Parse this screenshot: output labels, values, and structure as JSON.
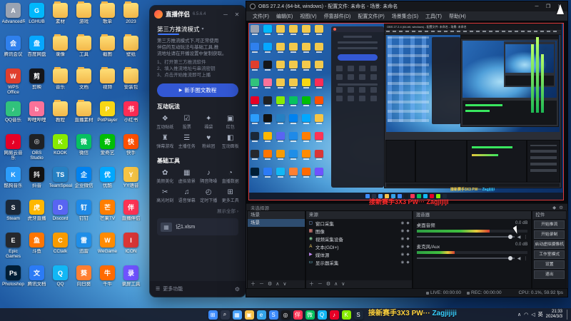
{
  "watermark": {
    "cn": "接新赛手3X3 PW···",
    "en": "Zagjijiji"
  },
  "window_controls": {
    "min": "─",
    "max": "❐",
    "close": "✕"
  },
  "desktop": {
    "icons": [
      {
        "label": "AdvancedRun",
        "color": "#9aa3b2",
        "glyph": "A",
        "type": "app"
      },
      {
        "label": "腾讯会议",
        "color": "#2f80ed",
        "glyph": "会",
        "type": "app"
      },
      {
        "label": "WPS Office",
        "color": "#e03e2d",
        "glyph": "W",
        "type": "app"
      },
      {
        "label": "QQ音乐",
        "color": "#31c27c",
        "glyph": "♪",
        "type": "app"
      },
      {
        "label": "网易云音乐",
        "color": "#e60026",
        "glyph": "♪",
        "type": "app"
      },
      {
        "label": "酷狗音乐",
        "color": "#2c9dfb",
        "glyph": "K",
        "type": "app"
      },
      {
        "label": "Steam",
        "color": "#1b2838",
        "glyph": "S",
        "type": "app"
      },
      {
        "label": "Epic Games",
        "color": "#26282d",
        "glyph": "E",
        "type": "app"
      },
      {
        "label": "Photoshop",
        "color": "#001e36",
        "glyph": "Ps",
        "type": "app"
      },
      {
        "label": "LGHUB",
        "color": "#00b8fc",
        "glyph": "G",
        "type": "app"
      },
      {
        "label": "百度网盘",
        "color": "#06a7ff",
        "glyph": "盘",
        "type": "app"
      },
      {
        "label": "剪映",
        "color": "#15161a",
        "glyph": "剪",
        "type": "app"
      },
      {
        "label": "哔哩哔哩",
        "color": "#fb7299",
        "glyph": "b",
        "type": "app"
      },
      {
        "label": "OBS Studio",
        "color": "#1f2124",
        "glyph": "◎",
        "type": "app"
      },
      {
        "label": "抖音",
        "color": "#121212",
        "glyph": "抖",
        "type": "app"
      },
      {
        "label": "虎牙直播",
        "color": "#ffb700",
        "glyph": "虎",
        "type": "app"
      },
      {
        "label": "斗鱼",
        "color": "#ff7500",
        "glyph": "鱼",
        "type": "app"
      },
      {
        "label": "腾讯文档",
        "color": "#2b7bf6",
        "glyph": "文",
        "type": "app"
      },
      {
        "label": "素材",
        "color": "",
        "glyph": "",
        "type": "folder"
      },
      {
        "label": "录像",
        "color": "",
        "glyph": "",
        "type": "folder"
      },
      {
        "label": "音乐",
        "color": "",
        "glyph": "",
        "type": "folder"
      },
      {
        "label": "教程",
        "color": "",
        "glyph": "",
        "type": "folder"
      },
      {
        "label": "KOOK",
        "color": "#87eb00",
        "glyph": "K",
        "type": "app"
      },
      {
        "label": "TeamSpeak",
        "color": "#2580c3",
        "glyph": "TS",
        "type": "app"
      },
      {
        "label": "Discord",
        "color": "#5865f2",
        "glyph": "D",
        "type": "app"
      },
      {
        "label": "CCtalk",
        "color": "#f89b00",
        "glyph": "C",
        "type": "app"
      },
      {
        "label": "QQ",
        "color": "#12b7f5",
        "glyph": "Q",
        "type": "app"
      },
      {
        "label": "游戏",
        "color": "",
        "glyph": "",
        "type": "folder"
      },
      {
        "label": "工具",
        "color": "",
        "glyph": "",
        "type": "folder"
      },
      {
        "label": "文档",
        "color": "",
        "glyph": "",
        "type": "folder"
      },
      {
        "label": "直播素材",
        "color": "",
        "glyph": "",
        "type": "folder"
      },
      {
        "label": "微信",
        "color": "#07c160",
        "glyph": "微",
        "type": "app"
      },
      {
        "label": "企业微信",
        "color": "#0082ef",
        "glyph": "企",
        "type": "app"
      },
      {
        "label": "钉钉",
        "color": "#1e8ae8",
        "glyph": "钉",
        "type": "app"
      },
      {
        "label": "迅雷",
        "color": "#1f8ee8",
        "glyph": "雷",
        "type": "app"
      },
      {
        "label": "向日葵",
        "color": "#ff7f32",
        "glyph": "葵",
        "type": "app"
      },
      {
        "label": "歌单",
        "color": "",
        "glyph": "",
        "type": "folder"
      },
      {
        "label": "截图",
        "color": "",
        "glyph": "",
        "type": "folder"
      },
      {
        "label": "视频",
        "color": "",
        "glyph": "",
        "type": "folder"
      },
      {
        "label": "PotPlayer",
        "color": "#f8d714",
        "glyph": "P",
        "type": "app"
      },
      {
        "label": "爱奇艺",
        "color": "#00be06",
        "glyph": "奇",
        "type": "app"
      },
      {
        "label": "优酷",
        "color": "#00a8ff",
        "glyph": "优",
        "type": "app"
      },
      {
        "label": "芒果TV",
        "color": "#ff7e00",
        "glyph": "芒",
        "type": "app"
      },
      {
        "label": "WeGame",
        "color": "#ff8b00",
        "glyph": "W",
        "type": "app"
      },
      {
        "label": "千牛",
        "color": "#ff6a00",
        "glyph": "牛",
        "type": "app"
      },
      {
        "label": "2023",
        "color": "",
        "glyph": "",
        "type": "folder"
      },
      {
        "label": "壁纸",
        "color": "",
        "glyph": "",
        "type": "folder"
      },
      {
        "label": "安装包",
        "color": "",
        "glyph": "",
        "type": "folder"
      },
      {
        "label": "小红书",
        "color": "#fe2c55",
        "glyph": "书",
        "type": "app"
      },
      {
        "label": "快手",
        "color": "#ff5000",
        "glyph": "快",
        "type": "app"
      },
      {
        "label": "YY语音",
        "color": "#f6c445",
        "glyph": "Y",
        "type": "app"
      },
      {
        "label": "直播伴侣",
        "color": "#ff3355",
        "glyph": "伴",
        "type": "app"
      },
      {
        "label": "ICON",
        "color": "#d93636",
        "glyph": "I",
        "type": "app"
      },
      {
        "label": "录屏工具",
        "color": "#6f52ff",
        "glyph": "录",
        "type": "app"
      }
    ]
  },
  "companion": {
    "title": "直播伴侣",
    "version": "6.5.6.4",
    "mode_tab": "第三方推流模式",
    "desc_lines": [
      "第三方推流模式下,可正常使用",
      "伴侣的互动玩法与基础工具,推",
      "流地址请在开播设置中复制获取。"
    ],
    "steps": [
      "1、打开第三方推流软件",
      "2、填入推流地址与串流密钥",
      "3、点击开始推流即可上播"
    ],
    "tutorial_button": "新手图文教程",
    "sections": [
      {
        "title": "互动玩法",
        "items": [
          {
            "label": "互动贴纸",
            "glyph": "❖"
          },
          {
            "label": "投票",
            "glyph": "☑"
          },
          {
            "label": "福袋",
            "glyph": "✦"
          },
          {
            "label": "红包",
            "glyph": "▣"
          },
          {
            "label": "弹幕游戏",
            "glyph": "♜"
          },
          {
            "label": "主播任务",
            "glyph": "☰"
          },
          {
            "label": "粉丝团",
            "glyph": "♥"
          },
          {
            "label": "互动面板",
            "glyph": "◧"
          }
        ]
      },
      {
        "title": "基础工具",
        "items": [
          {
            "label": "美颜美化",
            "glyph": "✿"
          },
          {
            "label": "虚拟背景",
            "glyph": "▦"
          },
          {
            "label": "隔音降噪",
            "glyph": "♪"
          },
          {
            "label": "直播数据",
            "glyph": "◔"
          },
          {
            "label": "高光时刻",
            "glyph": "✂"
          },
          {
            "label": "语音弹幕",
            "glyph": "♫"
          },
          {
            "label": "定时下播",
            "glyph": "◴"
          },
          {
            "label": "更多工具",
            "glyph": "⊞"
          }
        ]
      }
    ],
    "show_all": "展示全部 ›",
    "recent_file": "记1.xlsm",
    "footer": "更多功能"
  },
  "obs": {
    "title": "OBS 27.2.4 (64-bit, windows) - 配置文件: 未命名 - 场景: 未命名",
    "menu": [
      "文件(F)",
      "编辑(E)",
      "视图(V)",
      "停靠部件(D)",
      "配置文件(P)",
      "场景集合(S)",
      "工具(T)",
      "帮助(H)"
    ],
    "source_toolbar_text": "未选择源",
    "dock_toolbar": [
      {
        "name": "add-icon",
        "glyph": "＋"
      },
      {
        "name": "remove-icon",
        "glyph": "－"
      },
      {
        "name": "properties-icon",
        "glyph": "⚙"
      },
      {
        "name": "move-up-icon",
        "glyph": "∧"
      },
      {
        "name": "move-down-icon",
        "glyph": "∨"
      }
    ],
    "docks": {
      "scenes": {
        "title": "场景",
        "items": [
          "场景"
        ]
      },
      "sources": {
        "title": "来源",
        "items": [
          {
            "name": "窗口采集",
            "glyph": "▢",
            "color": "#8ab4f8"
          },
          {
            "name": "图像",
            "glyph": "▦",
            "color": "#f28b82"
          },
          {
            "name": "视频采集设备",
            "glyph": "◉",
            "color": "#81c995"
          },
          {
            "name": "文本(GDI+)",
            "glyph": "A",
            "color": "#fdd663"
          },
          {
            "name": "媒体源",
            "glyph": "▶",
            "color": "#c58af9"
          },
          {
            "name": "显示器采集",
            "glyph": "▭",
            "color": "#78d9ec"
          }
        ]
      },
      "mixer": {
        "title": "混音器",
        "channels": [
          {
            "name": "桌面音频",
            "db": "0.0 dB",
            "level": 0.66,
            "slider": 0.96
          },
          {
            "name": "麦克风/Aux",
            "db": "0.0 dB",
            "level": 0.34,
            "slider": 0.96
          }
        ]
      },
      "controls": {
        "title": "控件",
        "buttons": [
          "开始推流",
          "开始录制",
          "启动虚拟摄像机",
          "工作室模式",
          "设置",
          "退出"
        ]
      }
    },
    "status": {
      "live": "LIVE: 00:00:00",
      "rec": "REC: 00:00:00",
      "cpu": "CPU: 0.1%, 59.92 fps"
    }
  },
  "taskbar": {
    "icons": [
      {
        "name": "start",
        "color": "#3d8bfd",
        "glyph": "⊞"
      },
      {
        "name": "search",
        "color": "#2a3346",
        "glyph": "⌕"
      },
      {
        "name": "widgets",
        "color": "#4aa3ff",
        "glyph": "▦"
      },
      {
        "name": "explorer",
        "color": "#f8c24a",
        "glyph": "▣"
      },
      {
        "name": "edge",
        "color": "#35a3e8",
        "glyph": "e"
      },
      {
        "name": "store",
        "color": "#3d8bfd",
        "glyph": "S"
      },
      {
        "name": "obs",
        "color": "#17191d",
        "glyph": "◎"
      },
      {
        "name": "live-companion",
        "color": "#ff3355",
        "glyph": "伴"
      },
      {
        "name": "wechat",
        "color": "#07c160",
        "glyph": "微"
      },
      {
        "name": "qq",
        "color": "#12b7f5",
        "glyph": "Q"
      },
      {
        "name": "netease-music",
        "color": "#e60026",
        "glyph": "♪"
      },
      {
        "name": "kook",
        "color": "#87eb00",
        "glyph": "K"
      },
      {
        "name": "steam",
        "color": "#1b2838",
        "glyph": "S"
      }
    ],
    "tray": {
      "icons": [
        {
          "name": "tray-chevron-icon",
          "glyph": "∧"
        },
        {
          "name": "wifi-icon",
          "glyph": "◠"
        },
        {
          "name": "volume-icon",
          "glyph": "◁"
        }
      ],
      "ime": "英",
      "time": "21:33",
      "date": "2024/3/3"
    }
  }
}
